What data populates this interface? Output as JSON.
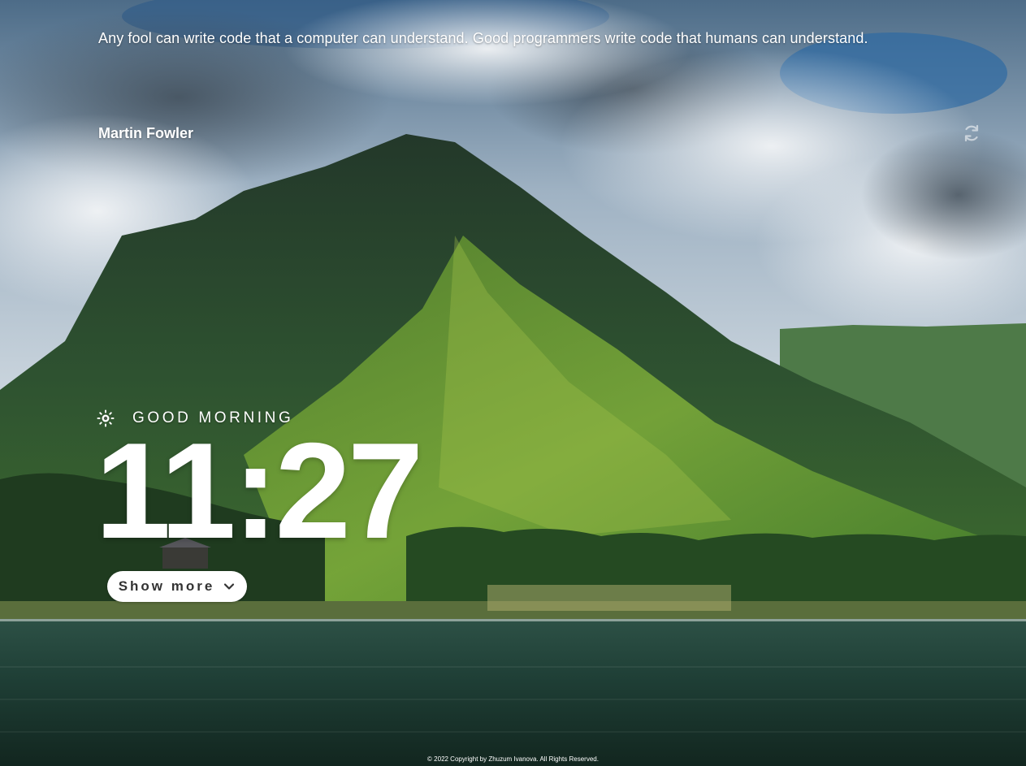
{
  "quote": {
    "text": "Any fool can write code that a computer can understand. Good programmers write code that humans can understand.",
    "author": "Martin Fowler",
    "refresh_icon": "refresh-icon"
  },
  "time": {
    "greeting": "GOOD MORNING",
    "greeting_icon": "sun-icon",
    "clock": "11:27"
  },
  "controls": {
    "show_more_label": "Show more",
    "show_more_icon": "chevron-down-icon"
  },
  "footer": {
    "copyright": "© 2022 Copyright by Zhuzum Ivanova. All Rights Reserved."
  },
  "background": {
    "image": "mountain-lake-photo"
  }
}
